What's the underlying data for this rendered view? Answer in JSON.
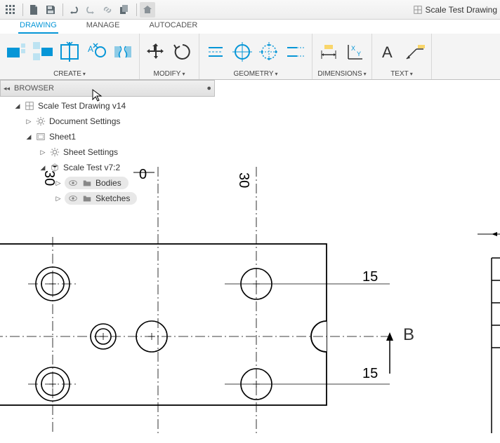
{
  "title": "Scale Test Drawing",
  "tabs": {
    "drawing": "DRAWING",
    "manage": "MANAGE",
    "autocader": "AUTOCADER"
  },
  "panels": {
    "create": "CREATE",
    "modify": "MODIFY",
    "geometry": "GEOMETRY",
    "dimensions": "DIMENSIONS",
    "text": "TEXT"
  },
  "browser": {
    "title": "BROWSER",
    "root": "Scale Test Drawing v14",
    "doc_settings": "Document Settings",
    "sheet": "Sheet1",
    "sheet_settings": "Sheet Settings",
    "component": "Scale Test v7:2",
    "bodies": "Bodies",
    "sketches": "Sketches"
  },
  "dims": {
    "top_left": "0",
    "left_vert": "30",
    "top_right": "30",
    "r1": "15",
    "r2": "15",
    "section": "B"
  }
}
